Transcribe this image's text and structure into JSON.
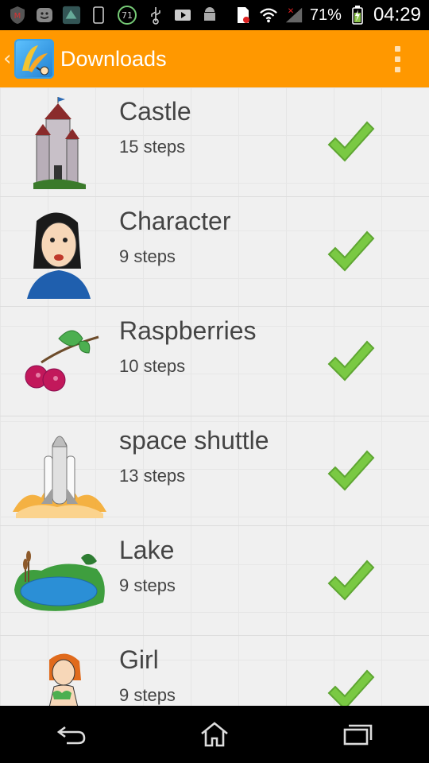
{
  "status_bar": {
    "battery_percent": "71%",
    "time": "04:29",
    "notification_badge": "71"
  },
  "app_bar": {
    "title": "Downloads"
  },
  "items": [
    {
      "title": "Castle",
      "steps": "15 steps",
      "icon": "castle-icon"
    },
    {
      "title": "Character",
      "steps": "9 steps",
      "icon": "character-icon"
    },
    {
      "title": "Raspberries",
      "steps": "10 steps",
      "icon": "raspberries-icon"
    },
    {
      "title": "space shuttle",
      "steps": "13 steps",
      "icon": "space-shuttle-icon"
    },
    {
      "title": "Lake",
      "steps": "9 steps",
      "icon": "lake-icon"
    },
    {
      "title": "Girl",
      "steps": "9 steps",
      "icon": "girl-icon"
    }
  ],
  "colors": {
    "app_bar": "#ff9800",
    "check": "#7ac943"
  }
}
